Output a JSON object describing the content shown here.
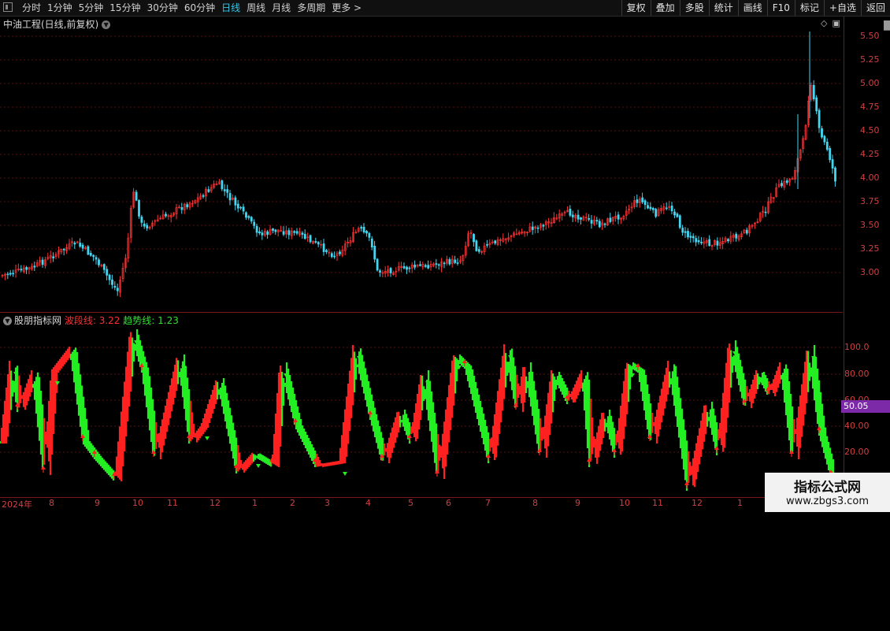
{
  "toolbar": {
    "tabs": [
      "分时",
      "1分钟",
      "5分钟",
      "15分钟",
      "30分钟",
      "60分钟",
      "日线",
      "周线",
      "月线",
      "多周期",
      "更多 >"
    ],
    "active_tab": "日线",
    "right_tools": [
      "复权",
      "叠加",
      "多股",
      "统计",
      "画线",
      "F10",
      "标记",
      "+自选",
      "返回"
    ]
  },
  "main_chart": {
    "title": "中油工程(日线,前复权)",
    "price_labels": [
      "5.50",
      "5.25",
      "5.00",
      "4.75",
      "4.50",
      "4.25",
      "4.00",
      "3.75",
      "3.50",
      "3.25",
      "3.00"
    ],
    "colors": {
      "up": "#ff3333",
      "down": "#44d6f0",
      "grid": "#5a0f0f"
    }
  },
  "indicator": {
    "name": "股朋指标网",
    "wave_label": "波段线:",
    "wave_value": "3.22",
    "trend_label": "趋势线:",
    "trend_value": "1.23",
    "levels": [
      "100.0",
      "80.00",
      "60.00",
      "40.00",
      "20.00"
    ],
    "current_badge": "50.05",
    "colors": {
      "wave": "#ff2020",
      "trend": "#22ee22",
      "badge": "#7c2aa8"
    }
  },
  "x_axis": {
    "labels": [
      "2024年",
      "8",
      "9",
      "10",
      "11",
      "12",
      "1",
      "2",
      "3",
      "4",
      "5",
      "6",
      "7",
      "8",
      "9",
      "10",
      "11",
      "12",
      "1"
    ]
  },
  "watermark": {
    "title": "指标公式网",
    "url": "www.zbgs3.com"
  }
}
